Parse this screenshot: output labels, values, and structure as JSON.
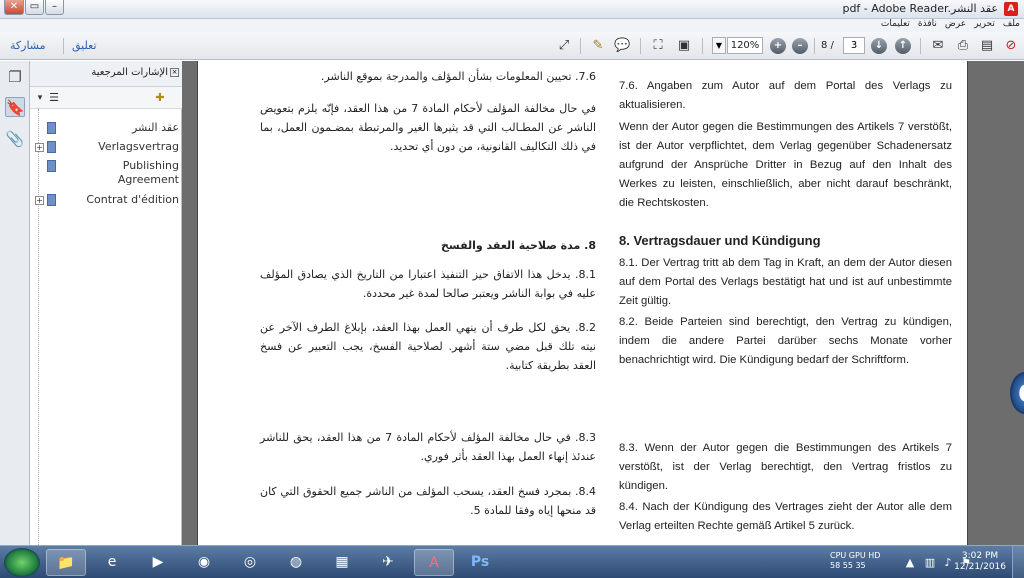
{
  "window": {
    "title": "pdf - Adobe Reader.عقد النشر",
    "icon": "acrobat-pdf-icon"
  },
  "menu": {
    "items": [
      "ملف",
      "تحرير",
      "عرض",
      "نافذة",
      "تعليمات"
    ]
  },
  "toolbar": {
    "share_label": "مشاركة",
    "comment_label": "تعليق",
    "zoom": "120%",
    "page_current": "3",
    "page_total": "8 /"
  },
  "bookmarks": {
    "title": "الإشارات المرجعية",
    "items": [
      {
        "label": "عقد النشر",
        "expandable": false
      },
      {
        "label": "Verlagsvertrag",
        "expandable": true
      },
      {
        "label": "Publishing Agreement",
        "expandable": false
      },
      {
        "label": "Contrat d'édition",
        "expandable": true
      }
    ]
  },
  "document": {
    "arabic": [
      "7.6. تحيين المعلومات بشأن المؤلف والمدرجة بموقع الناشر.",
      "في حال مخالفة المؤلف لأحكام المادة 7 من هذا العقد، فإنّه يلزم بتعويض الناشر عن المطـالب التي قد يثيرها الغير والمرتبطة بمضـمون العمل، بما في ذلك التكاليف القانونية، من دون أي تحديد.",
      "8. مدة صلاحية العقد والفسخ",
      "8.1. يدخل هذا الاتفاق حيز التنفيذ اعتبارا من التاريخ الذي يصادق المؤلف عليه في بوابة الناشر ويعتبر صالحا لمدة غير محددة.",
      "8.2. يحق لكل طرف أن ينهي العمل بهذا العقد، بإبلاغ الطرف الآخر عن نيته تلك قبل مضي ستة أشهر. لصلاحية الفسخ، يجب التعبير عن فسخ العقد بطريقة كتابية.",
      "8.3. في حال مخالفة المؤلف لأحكام المادة 7 من هذا العقد، يحق للناشر عندئذ إنهاء العمل بهذا العقد بأثر فوري.",
      "8.4. بمجرد فسخ العقد، يسحب المؤلف من الناشر جميع الحقوق التي كان قد منحها إياه وفقا للمادة 5."
    ],
    "german": [
      "7.6. Angaben zum Autor auf dem Portal des Verlags zu aktualisieren.",
      "Wenn der Autor gegen die Bestimmungen des Artikels 7 verstößt, ist der Autor verpflichtet, dem Verlag gegenüber Schadenersatz aufgrund der Ansprüche Dritter in Bezug auf den Inhalt des Werkes zu leisten, einschließlich, aber nicht darauf beschränkt, die Rechtskosten.",
      "8. Vertragsdauer und Kündigung",
      "8.1. Der Vertrag tritt ab dem Tag in Kraft, an dem der Autor diesen auf dem Portal des Verlags bestätigt hat und ist auf unbestimmte Zeit gültig.",
      "8.2. Beide Parteien sind berechtigt, den Vertrag zu kündigen, indem die andere Partei darüber sechs Monate vorher benachrichtigt wird. Die Kündigung bedarf der Schriftform.",
      "8.3. Wenn der Autor gegen die Bestimmungen des Artikels 7 verstößt, ist der Verlag berechtigt, den Vertrag fristlos zu kündigen.",
      "8.4. Nach der Kündigung des Vertrages zieht der Autor alle dem Verlag erteilten Rechte gemäß Artikel 5 zurück."
    ]
  },
  "taskbar": {
    "apps": [
      "explorer-icon",
      "ie-icon",
      "media-player-icon",
      "firefox-icon",
      "app-icon",
      "chrome-icon",
      "grid-app-icon",
      "mail-icon",
      "acrobat-icon",
      "photoshop-icon"
    ],
    "cpu_label": "CPU GPU HD",
    "cpu_values": "58   55   35",
    "time": "3:02 PM",
    "date": "12/21/2016"
  }
}
